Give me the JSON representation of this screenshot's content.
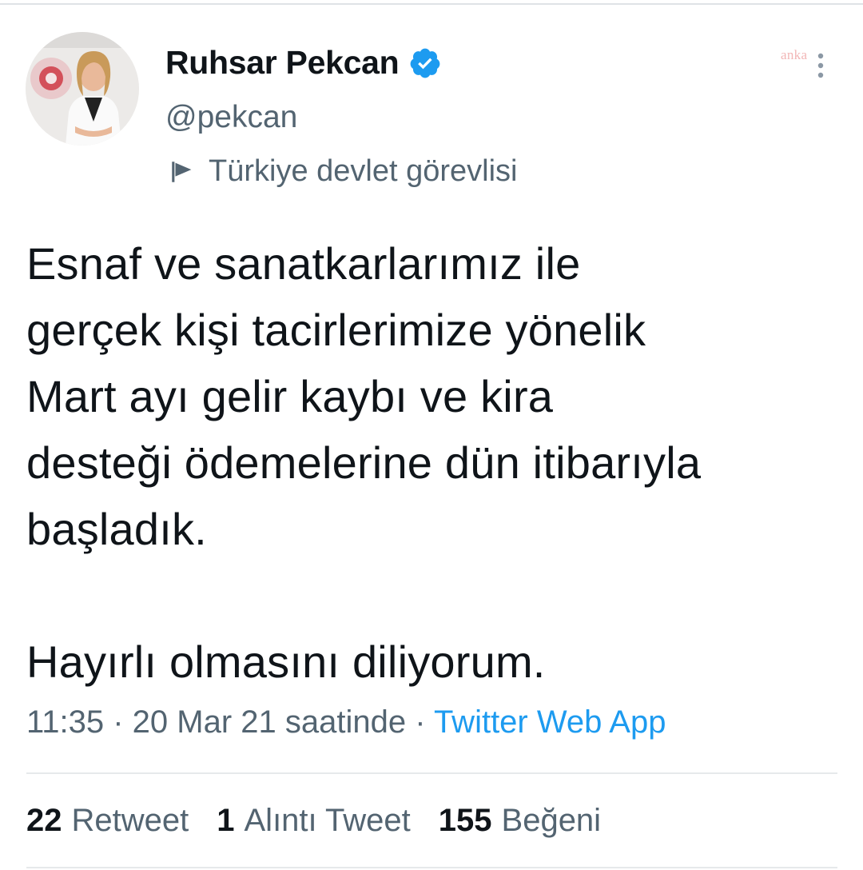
{
  "author": {
    "display_name": "Ruhsar Pekcan",
    "handle": "@pekcan",
    "verified_icon": "verified-badge-icon",
    "affiliation_label": "Türkiye devlet görevlisi",
    "affiliation_icon": "flag-icon"
  },
  "watermark": "anka",
  "more_icon": "more-vertical-icon",
  "tweet": {
    "lines": [
      "Esnaf ve sanatkarlarımız ile",
      "gerçek kişi tacirlerimize yönelik",
      "Mart ayı gelir kaybı ve kira",
      "desteği ödemelerine dün itibarıyla",
      "başladık.",
      "",
      "Hayırlı olmasını diliyorum."
    ],
    "timestamp": "11:35 · 20 Mar 21 saatinde",
    "separator": " · ",
    "source": "Twitter Web App"
  },
  "stats": {
    "retweets": {
      "count": "22",
      "label": "Retweet"
    },
    "quotes": {
      "count": "1",
      "label": "Alıntı Tweet"
    },
    "likes": {
      "count": "155",
      "label": "Beğeni"
    }
  },
  "colors": {
    "text": "#0f1419",
    "secondary": "#536471",
    "link": "#1d9bf0",
    "verified": "#1d9bf0"
  }
}
